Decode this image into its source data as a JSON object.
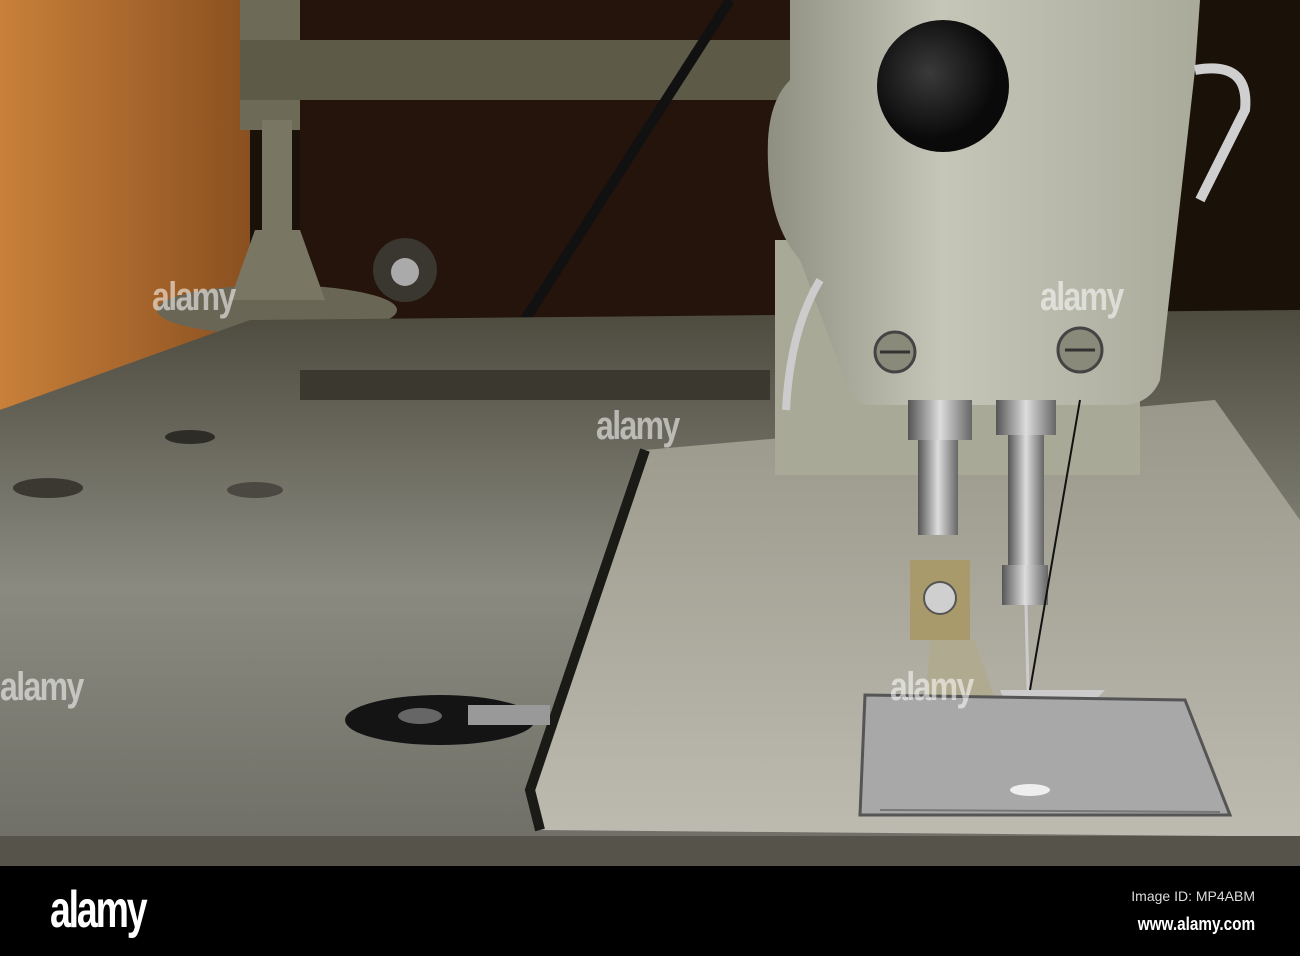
{
  "photo": {
    "subject": "sewing-machine",
    "watermark_text": "alamy"
  },
  "footer": {
    "logo": "alamy",
    "image_id": "Image ID: MP4ABM",
    "url": "www.alamy.com"
  }
}
